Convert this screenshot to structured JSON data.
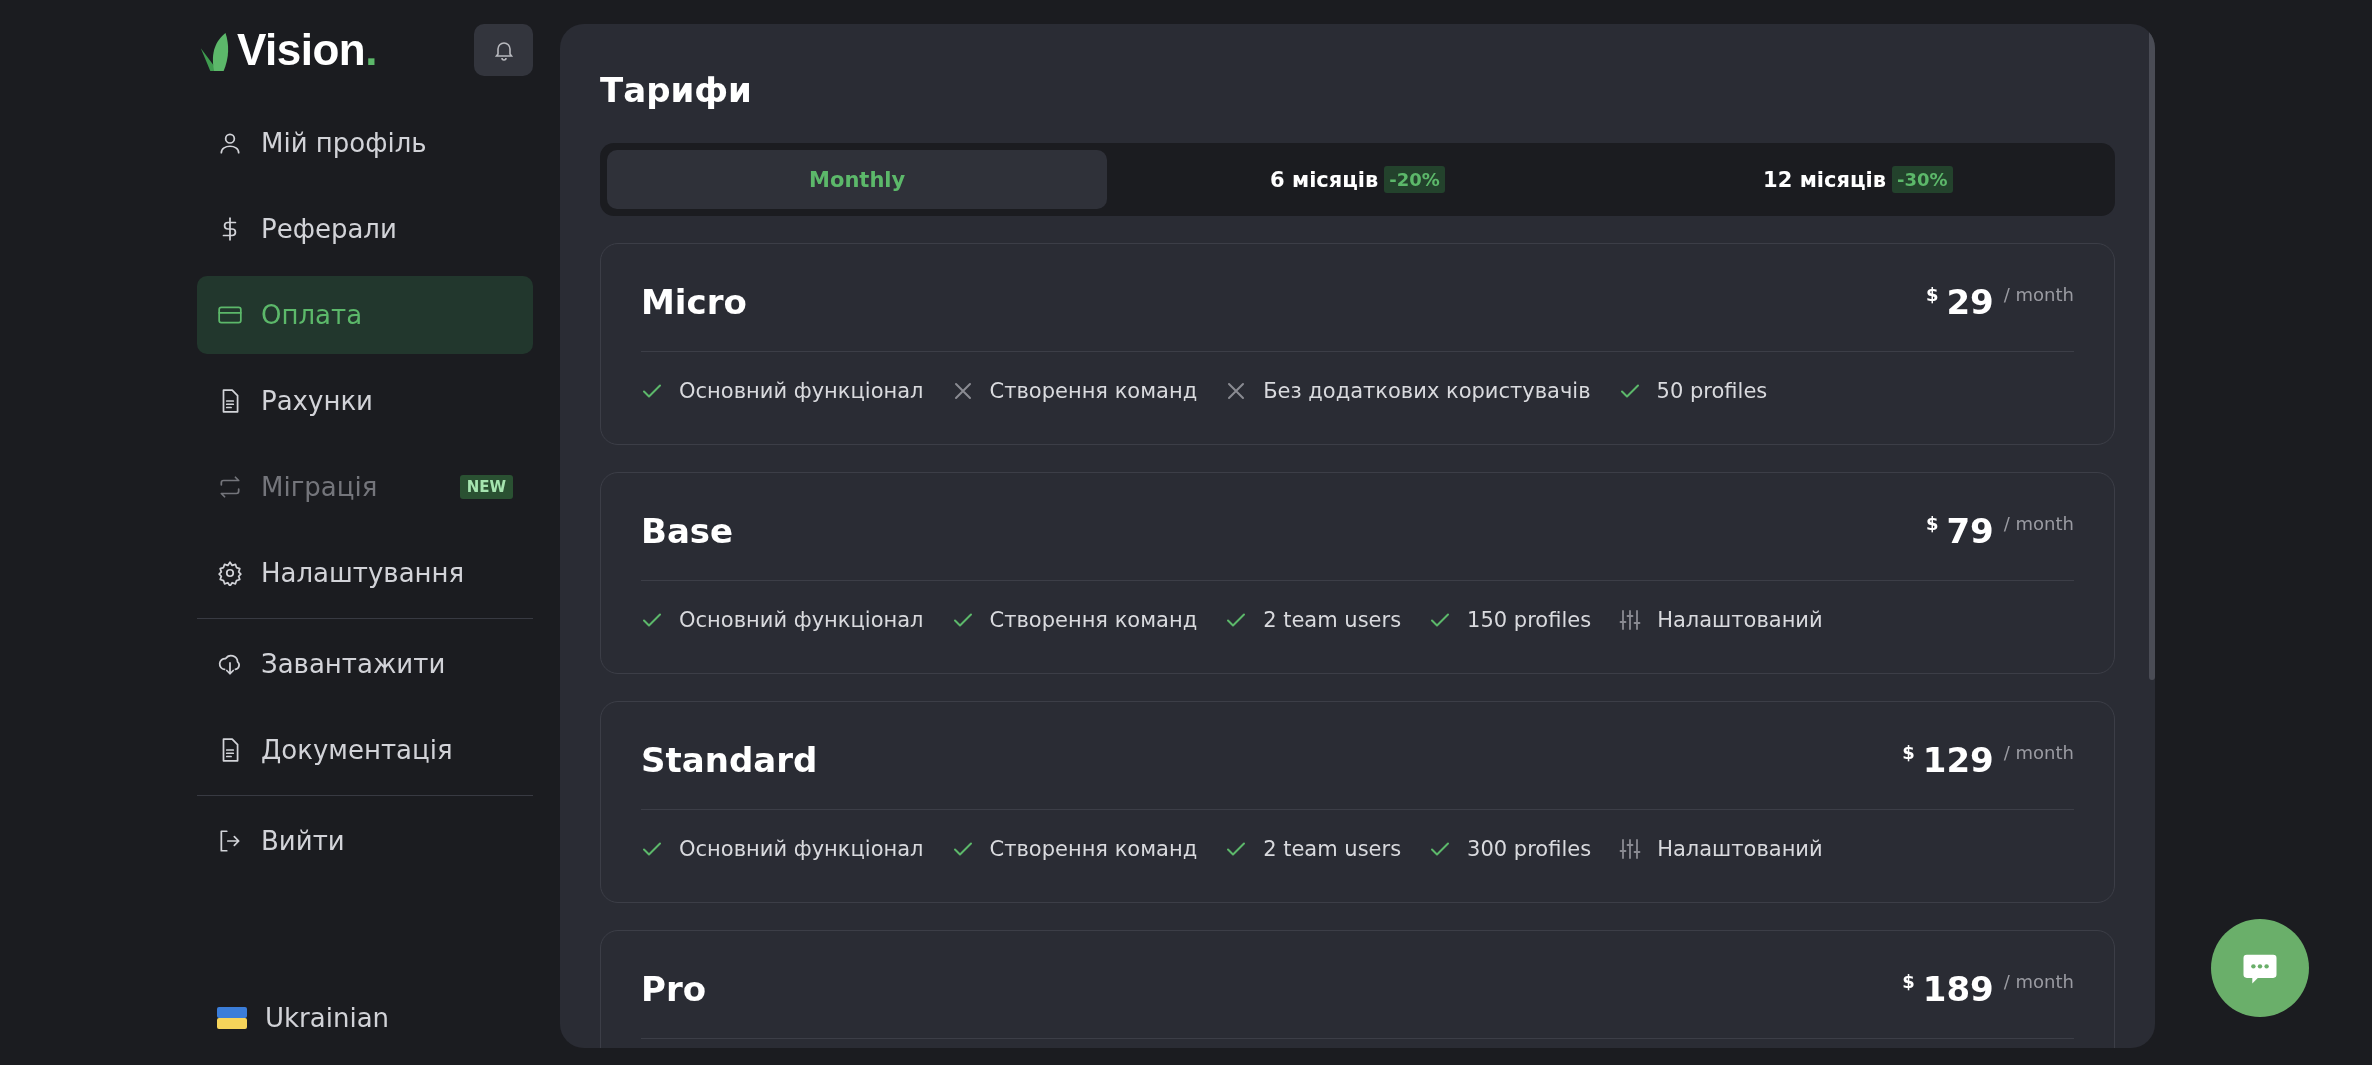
{
  "sidebar": {
    "logo": {
      "text": "Vision",
      "dot": "."
    },
    "nav": [
      {
        "label": "Мій профіль",
        "kind": "user",
        "selected": false,
        "disabled": false
      },
      {
        "label": "Реферали",
        "kind": "dollar",
        "selected": false,
        "disabled": false
      },
      {
        "label": "Оплата",
        "kind": "card",
        "selected": true,
        "disabled": false
      },
      {
        "label": "Рахунки",
        "kind": "doc",
        "selected": false,
        "disabled": false
      },
      {
        "label": "Міграція",
        "kind": "swap",
        "selected": false,
        "disabled": true,
        "badge": "NEW"
      },
      {
        "label": "Налаштування",
        "kind": "gear",
        "selected": false,
        "disabled": false
      }
    ],
    "nav_secondary": [
      {
        "label": "Завантажити",
        "kind": "download"
      },
      {
        "label": "Документація",
        "kind": "doc"
      }
    ],
    "logout": {
      "label": "Вийти"
    },
    "language": {
      "label": "Ukrainian"
    }
  },
  "main": {
    "title": "Тарифи",
    "tabs": [
      {
        "label": "Monthly",
        "selected": true
      },
      {
        "label": "6 місяців",
        "badge": "-20%",
        "selected": false
      },
      {
        "label": "12 місяців",
        "badge": "-30%",
        "selected": false
      }
    ],
    "plans": [
      {
        "name": "Micro",
        "price": {
          "currency": "$",
          "amount": "29",
          "period": "/ month"
        },
        "features": [
          {
            "kind": "yes",
            "text": "Основний функціонал"
          },
          {
            "kind": "no",
            "text": "Створення команд"
          },
          {
            "kind": "no",
            "text": "Без додаткових користувачів"
          },
          {
            "kind": "yes",
            "text": "50 profiles"
          }
        ]
      },
      {
        "name": "Base",
        "price": {
          "currency": "$",
          "amount": "79",
          "period": "/ month"
        },
        "features": [
          {
            "kind": "yes",
            "text": "Основний функціонал"
          },
          {
            "kind": "yes",
            "text": "Створення команд"
          },
          {
            "kind": "yes",
            "text": "2 team users"
          },
          {
            "kind": "yes",
            "text": "150 profiles"
          },
          {
            "kind": "custom",
            "text": "Налаштований"
          }
        ]
      },
      {
        "name": "Standard",
        "price": {
          "currency": "$",
          "amount": "129",
          "period": "/ month"
        },
        "features": [
          {
            "kind": "yes",
            "text": "Основний функціонал"
          },
          {
            "kind": "yes",
            "text": "Створення команд"
          },
          {
            "kind": "yes",
            "text": "2 team users"
          },
          {
            "kind": "yes",
            "text": "300 profiles"
          },
          {
            "kind": "custom",
            "text": "Налаштований"
          }
        ]
      },
      {
        "name": "Pro",
        "price": {
          "currency": "$",
          "amount": "189",
          "period": "/ month"
        }
      }
    ]
  }
}
